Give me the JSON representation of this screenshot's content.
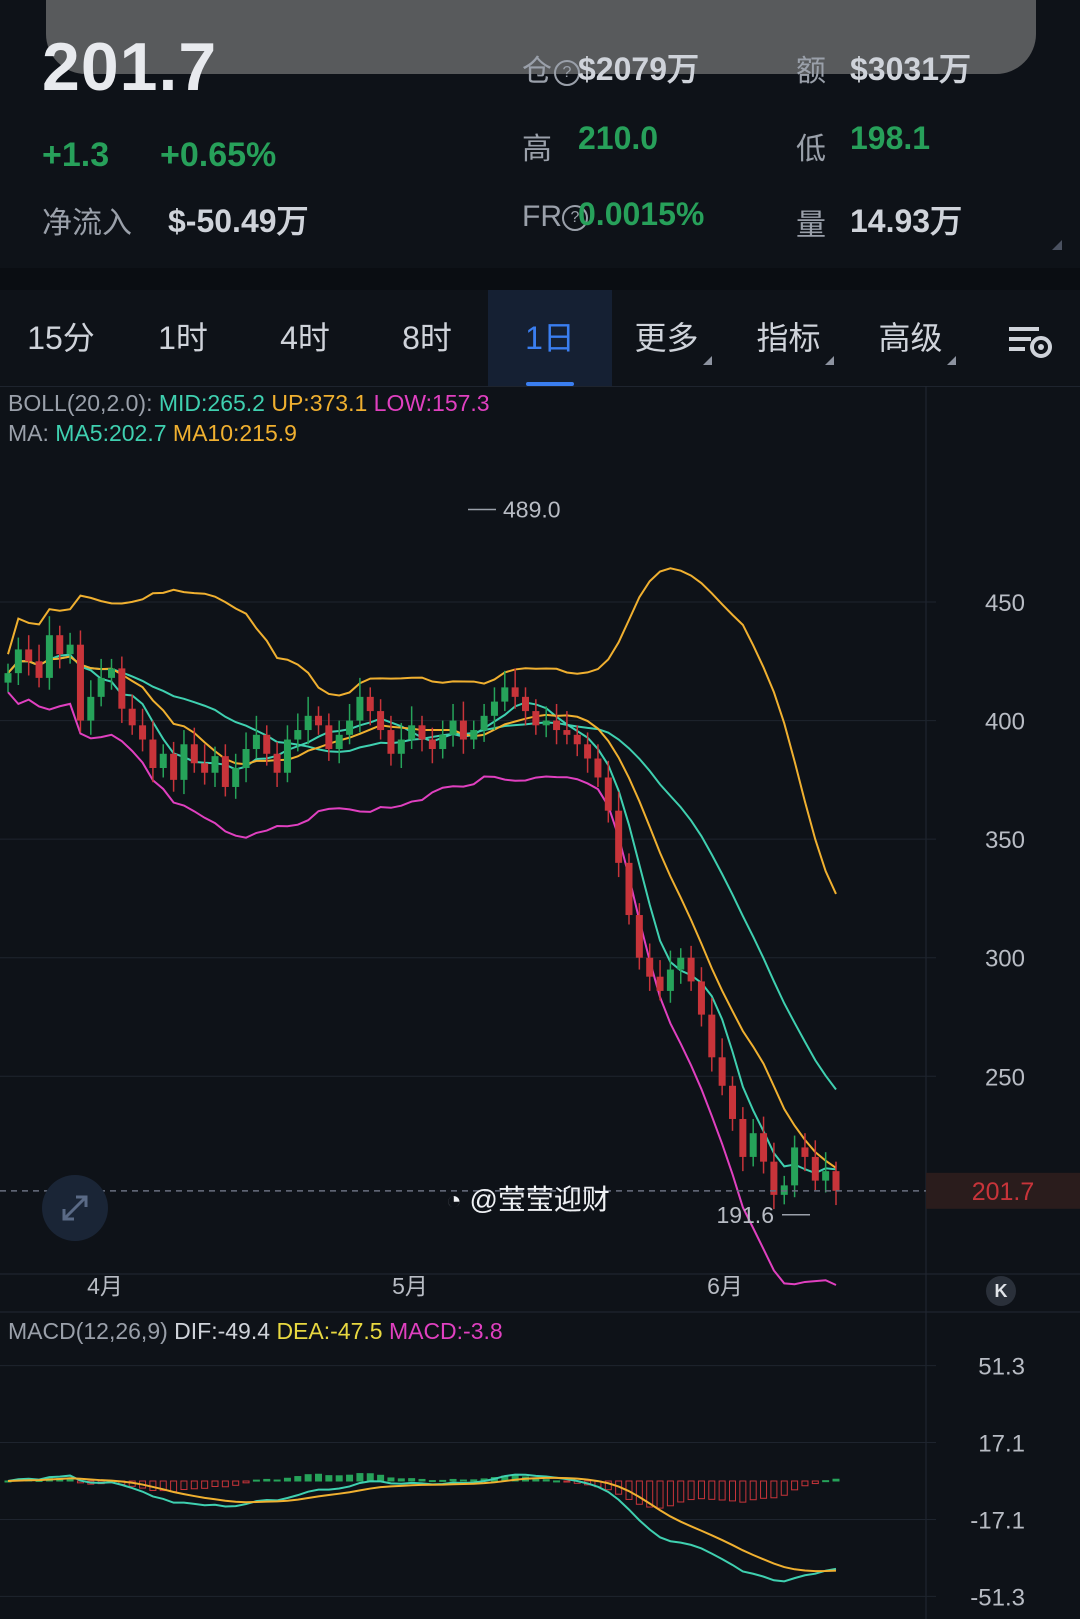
{
  "header": {
    "price": "201.7",
    "change": "+1.3",
    "change_pct": "+0.65%",
    "netflow_label": "净流入",
    "netflow_value": "$-50.49万",
    "oi_label": "仓",
    "oi_value": "$2079万",
    "amount_label": "额",
    "amount_value": "$3031万",
    "high_label": "高",
    "high_value": "210.0",
    "low_label": "低",
    "low_value": "198.1",
    "fr_label": "FR",
    "fr_value": "0.0015%",
    "volume_label": "量",
    "volume_value": "14.93万"
  },
  "tabs": [
    {
      "label": "15分"
    },
    {
      "label": "1时"
    },
    {
      "label": "4时"
    },
    {
      "label": "8时"
    },
    {
      "label": "1日",
      "active": true
    },
    {
      "label": "更多"
    },
    {
      "label": "指标"
    },
    {
      "label": "高级"
    }
  ],
  "indicators": {
    "boll_prefix": "BOLL(20,2.0):",
    "boll_mid": "MID:265.2",
    "boll_up": "UP:373.1",
    "boll_low": "LOW:157.3",
    "ma_prefix": "MA:",
    "ma5": "MA5:202.7",
    "ma10": "MA10:215.9",
    "macd_prefix": "MACD(12,26,9)",
    "macd_dif": "DIF:-49.4",
    "macd_dea": "DEA:-47.5",
    "macd_val": "MACD:-3.8"
  },
  "watermark": "@莹莹迎财",
  "colors": {
    "up": "#26a35a",
    "down": "#c8343a",
    "mid": "#3fd0b0",
    "upper": "#f0b030",
    "lower": "#e040c0",
    "accent": "#3a7ef0"
  },
  "chart_data": [
    {
      "type": "candlestick",
      "y_ticks": [
        "450",
        "400",
        "350",
        "300",
        "250"
      ],
      "x_ticks": [
        "4月",
        "5月",
        "6月"
      ],
      "ylim": [
        170,
        520
      ],
      "last_price": "201.7",
      "high_mark": "489.0",
      "low_mark": "191.6",
      "close_series": [
        420,
        430,
        425,
        418,
        436,
        428,
        432,
        400,
        410,
        418,
        422,
        405,
        398,
        392,
        380,
        386,
        375,
        390,
        382,
        378,
        385,
        372,
        380,
        388,
        394,
        386,
        378,
        392,
        396,
        402,
        398,
        388,
        394,
        400,
        410,
        404,
        396,
        386,
        392,
        398,
        392,
        388,
        394,
        400,
        392,
        396,
        402,
        408,
        414,
        410,
        404,
        398,
        400,
        396,
        394,
        390,
        384,
        376,
        362,
        340,
        318,
        300,
        292,
        286,
        295,
        300,
        290,
        276,
        258,
        246,
        232,
        216,
        226,
        214,
        200,
        204,
        220,
        216,
        206,
        210,
        201.7
      ]
    },
    {
      "type": "macd",
      "y_ticks": [
        "51.3",
        "17.1",
        "-17.1",
        "-51.3"
      ],
      "dif": -49.4,
      "dea": -47.5,
      "macd": -3.8
    }
  ]
}
